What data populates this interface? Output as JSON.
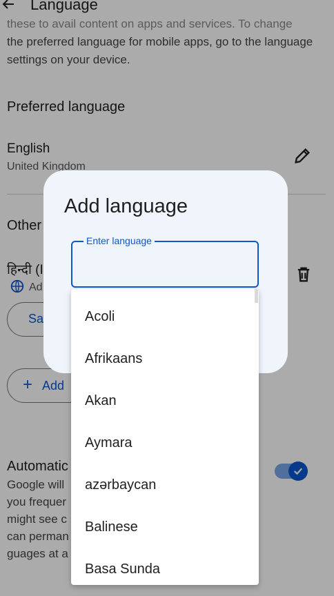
{
  "header": {
    "title": "Language"
  },
  "intro": {
    "faded_line": "these to avail content on apps and services. To change",
    "text": "the preferred language for mobile apps, go to the language settings on your device."
  },
  "preferred": {
    "section_title": "Preferred language",
    "language": "English",
    "region": "United Kingdom"
  },
  "other": {
    "section_title": "Other",
    "language": "हिन्दी (I",
    "auto_label": "Ad",
    "save_button": "Sa",
    "add_button": "Add"
  },
  "automatic": {
    "title": "Automatic",
    "lines": [
      "Google will",
      "you frequer",
      "might see c",
      "can perman",
      "guages at a"
    ]
  },
  "dialog": {
    "title": "Add language",
    "field_label": "Enter language",
    "field_value": ""
  },
  "dropdown": {
    "items": [
      "Acoli",
      "Afrikaans",
      "Akan",
      "Aymara",
      "azərbaycan",
      "Balinese",
      "Basa Sunda"
    ]
  },
  "colors": {
    "accent": "#0b57d0",
    "dialog_bg": "#f0f4fb"
  },
  "icons": [
    "back-arrow-icon",
    "pencil-icon",
    "trash-icon",
    "globe-icon",
    "plus-icon",
    "check-icon"
  ]
}
